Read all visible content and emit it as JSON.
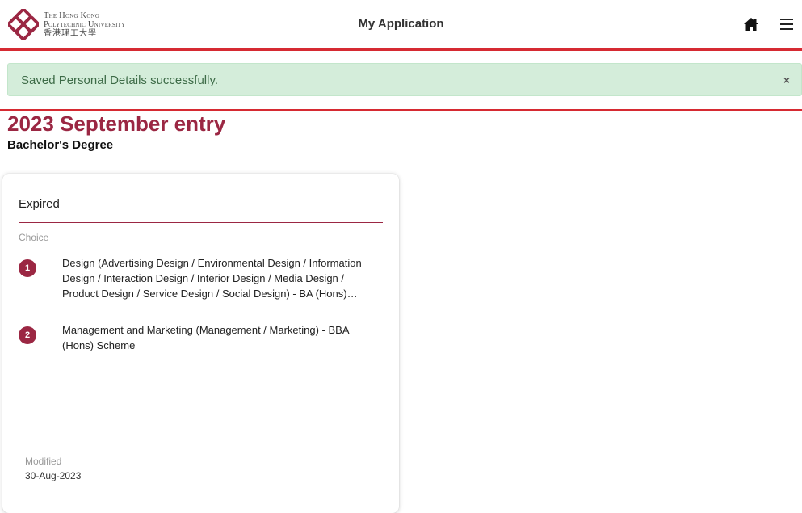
{
  "header": {
    "logo": {
      "line1": "The Hong Kong",
      "line2": "Polytechnic University",
      "line3": "香港理工大學"
    },
    "title": "My Application",
    "home_icon": "home-icon",
    "menu_icon": "hamburger-menu-icon"
  },
  "alert": {
    "message": "Saved Personal Details successfully.",
    "close": "×"
  },
  "entry": {
    "title": "2023 September entry",
    "degree": "Bachelor's Degree"
  },
  "card": {
    "status": "Expired",
    "choice_label": "Choice",
    "choices": [
      {
        "number": "1",
        "text": "Design (Advertising Design / Environmental Design / Information Design / Interaction Design / Interior Design / Media Design / Product Design / Service Design / Social Design) - BA (Hons) Scheme"
      },
      {
        "number": "2",
        "text": "Management and Marketing (Management / Marketing) - BBA (Hons) Scheme"
      }
    ],
    "modified_label": "Modified",
    "modified_date": "30-Aug-2023"
  },
  "colors": {
    "brand": "#9b2743",
    "accent_line": "#d62a32",
    "alert_bg": "#d4edda",
    "alert_text": "#3d6b47"
  }
}
